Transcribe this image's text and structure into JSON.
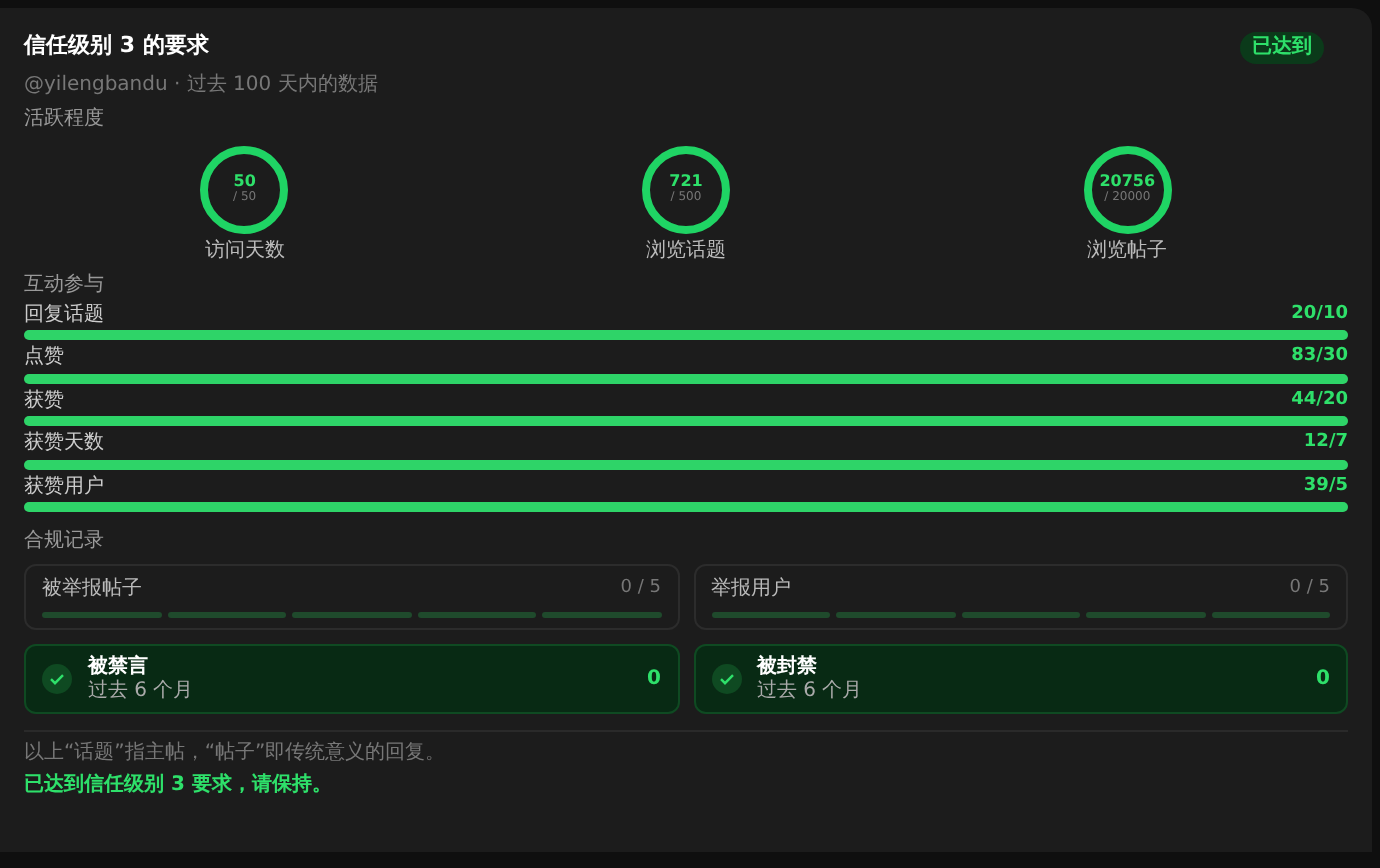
{
  "title": "信任级别 3 的要求",
  "badge": "已达到",
  "subtitle": "@yilengbandu · 过去 100 天内的数据",
  "activity": {
    "label": "活跃程度",
    "rings": [
      {
        "value": "50",
        "target": "/ 50",
        "label": "访问天数"
      },
      {
        "value": "721",
        "target": "/ 500",
        "label": "浏览话题"
      },
      {
        "value": "20756",
        "target": "/ 20000",
        "label": "浏览帖子"
      }
    ]
  },
  "engagement": {
    "label": "互动参与",
    "bars": [
      {
        "label": "回复话题",
        "reading": "20/10",
        "level": 1
      },
      {
        "label": "点赞",
        "reading": "83/30",
        "level": 1
      },
      {
        "label": "获赞",
        "reading": "44/20",
        "level": 1
      },
      {
        "label": "获赞天数",
        "reading": "12/7",
        "level": 1
      },
      {
        "label": "获赞用户",
        "reading": "39/5",
        "level": 1
      }
    ]
  },
  "compliance": {
    "label": "合规记录",
    "counters": [
      {
        "label": "被举报帖子",
        "reading": "0 / 5"
      },
      {
        "label": "举报用户",
        "reading": "0 / 5"
      }
    ],
    "statuses": [
      {
        "title": "被禁言",
        "period": "过去 6 个月",
        "count": "0",
        "passed": true
      },
      {
        "title": "被封禁",
        "period": "过去 6 个月",
        "count": "0",
        "passed": true
      }
    ]
  },
  "note": "以上“话题”指主帖，“帖子”即传统意义的回复。",
  "result": "已达到信任级别 3 要求，请保持。"
}
